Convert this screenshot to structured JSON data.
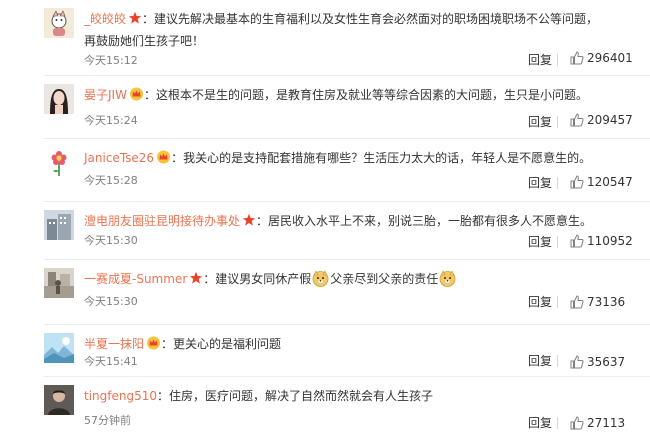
{
  "comments": [
    {
      "username": "_皎皎皎",
      "badge": "star",
      "colon": "：",
      "text": "建议先解决最基本的生育福利以及女性生育会必然面对的职场困境职场不公等问题，再鼓励她们生孩子吧！",
      "time": "今天15:12",
      "reply_label": "回复",
      "likes": "296401",
      "avatar_icon": "cartoon-avatar-icon"
    },
    {
      "username": "晏子JIW",
      "badge": "crown",
      "colon": "：",
      "text": "这根本不是生的问题，是教育住房及就业等等综合因素的大问题，生只是小问题。",
      "time": "今天15:24",
      "reply_label": "回复",
      "likes": "209457",
      "avatar_icon": "woman-photo-avatar-icon"
    },
    {
      "username": "JaniceTse26",
      "badge": "crown",
      "colon": "：",
      "text": "我关心的是支持配套措施有哪些？生活压力太大的话，年轻人是不愿意生的。",
      "time": "今天15:28",
      "reply_label": "回复",
      "likes": "120547",
      "avatar_icon": "flower-avatar-icon"
    },
    {
      "username": "澶电朋友圈驻昆明接待办事处",
      "badge": "star",
      "colon": "：",
      "text": "居民收入水平上不来，别说三胎，一胎都有很多人不愿意生。",
      "time": "今天15:30",
      "reply_label": "回复",
      "likes": "110952",
      "avatar_icon": "building-photo-avatar-icon"
    },
    {
      "username": "一赛成夏-Summer",
      "badge": "star",
      "colon": "：",
      "text": "建议男女同休产假",
      "text_after_emoji": "父亲尽到父亲的责任",
      "emoji_icon": "doge-emoji-icon",
      "time": "今天15:30",
      "reply_label": "回复",
      "likes": "73136",
      "avatar_icon": "street-photo-avatar-icon"
    },
    {
      "username": "半夏一抹阳",
      "badge": "crown",
      "colon": "：",
      "text": "更关心的是福利问题",
      "time": "今天15:41",
      "reply_label": "回复",
      "likes": "35637",
      "avatar_icon": "landscape-avatar-icon"
    },
    {
      "username": "tingfeng510",
      "colon": "：",
      "text": "住房，医疗问题，解决了自然而然就会有人生孩子",
      "time": "57分钟前",
      "reply_label": "回复",
      "likes": "27113",
      "avatar_icon": "person-photo-avatar-icon"
    }
  ]
}
